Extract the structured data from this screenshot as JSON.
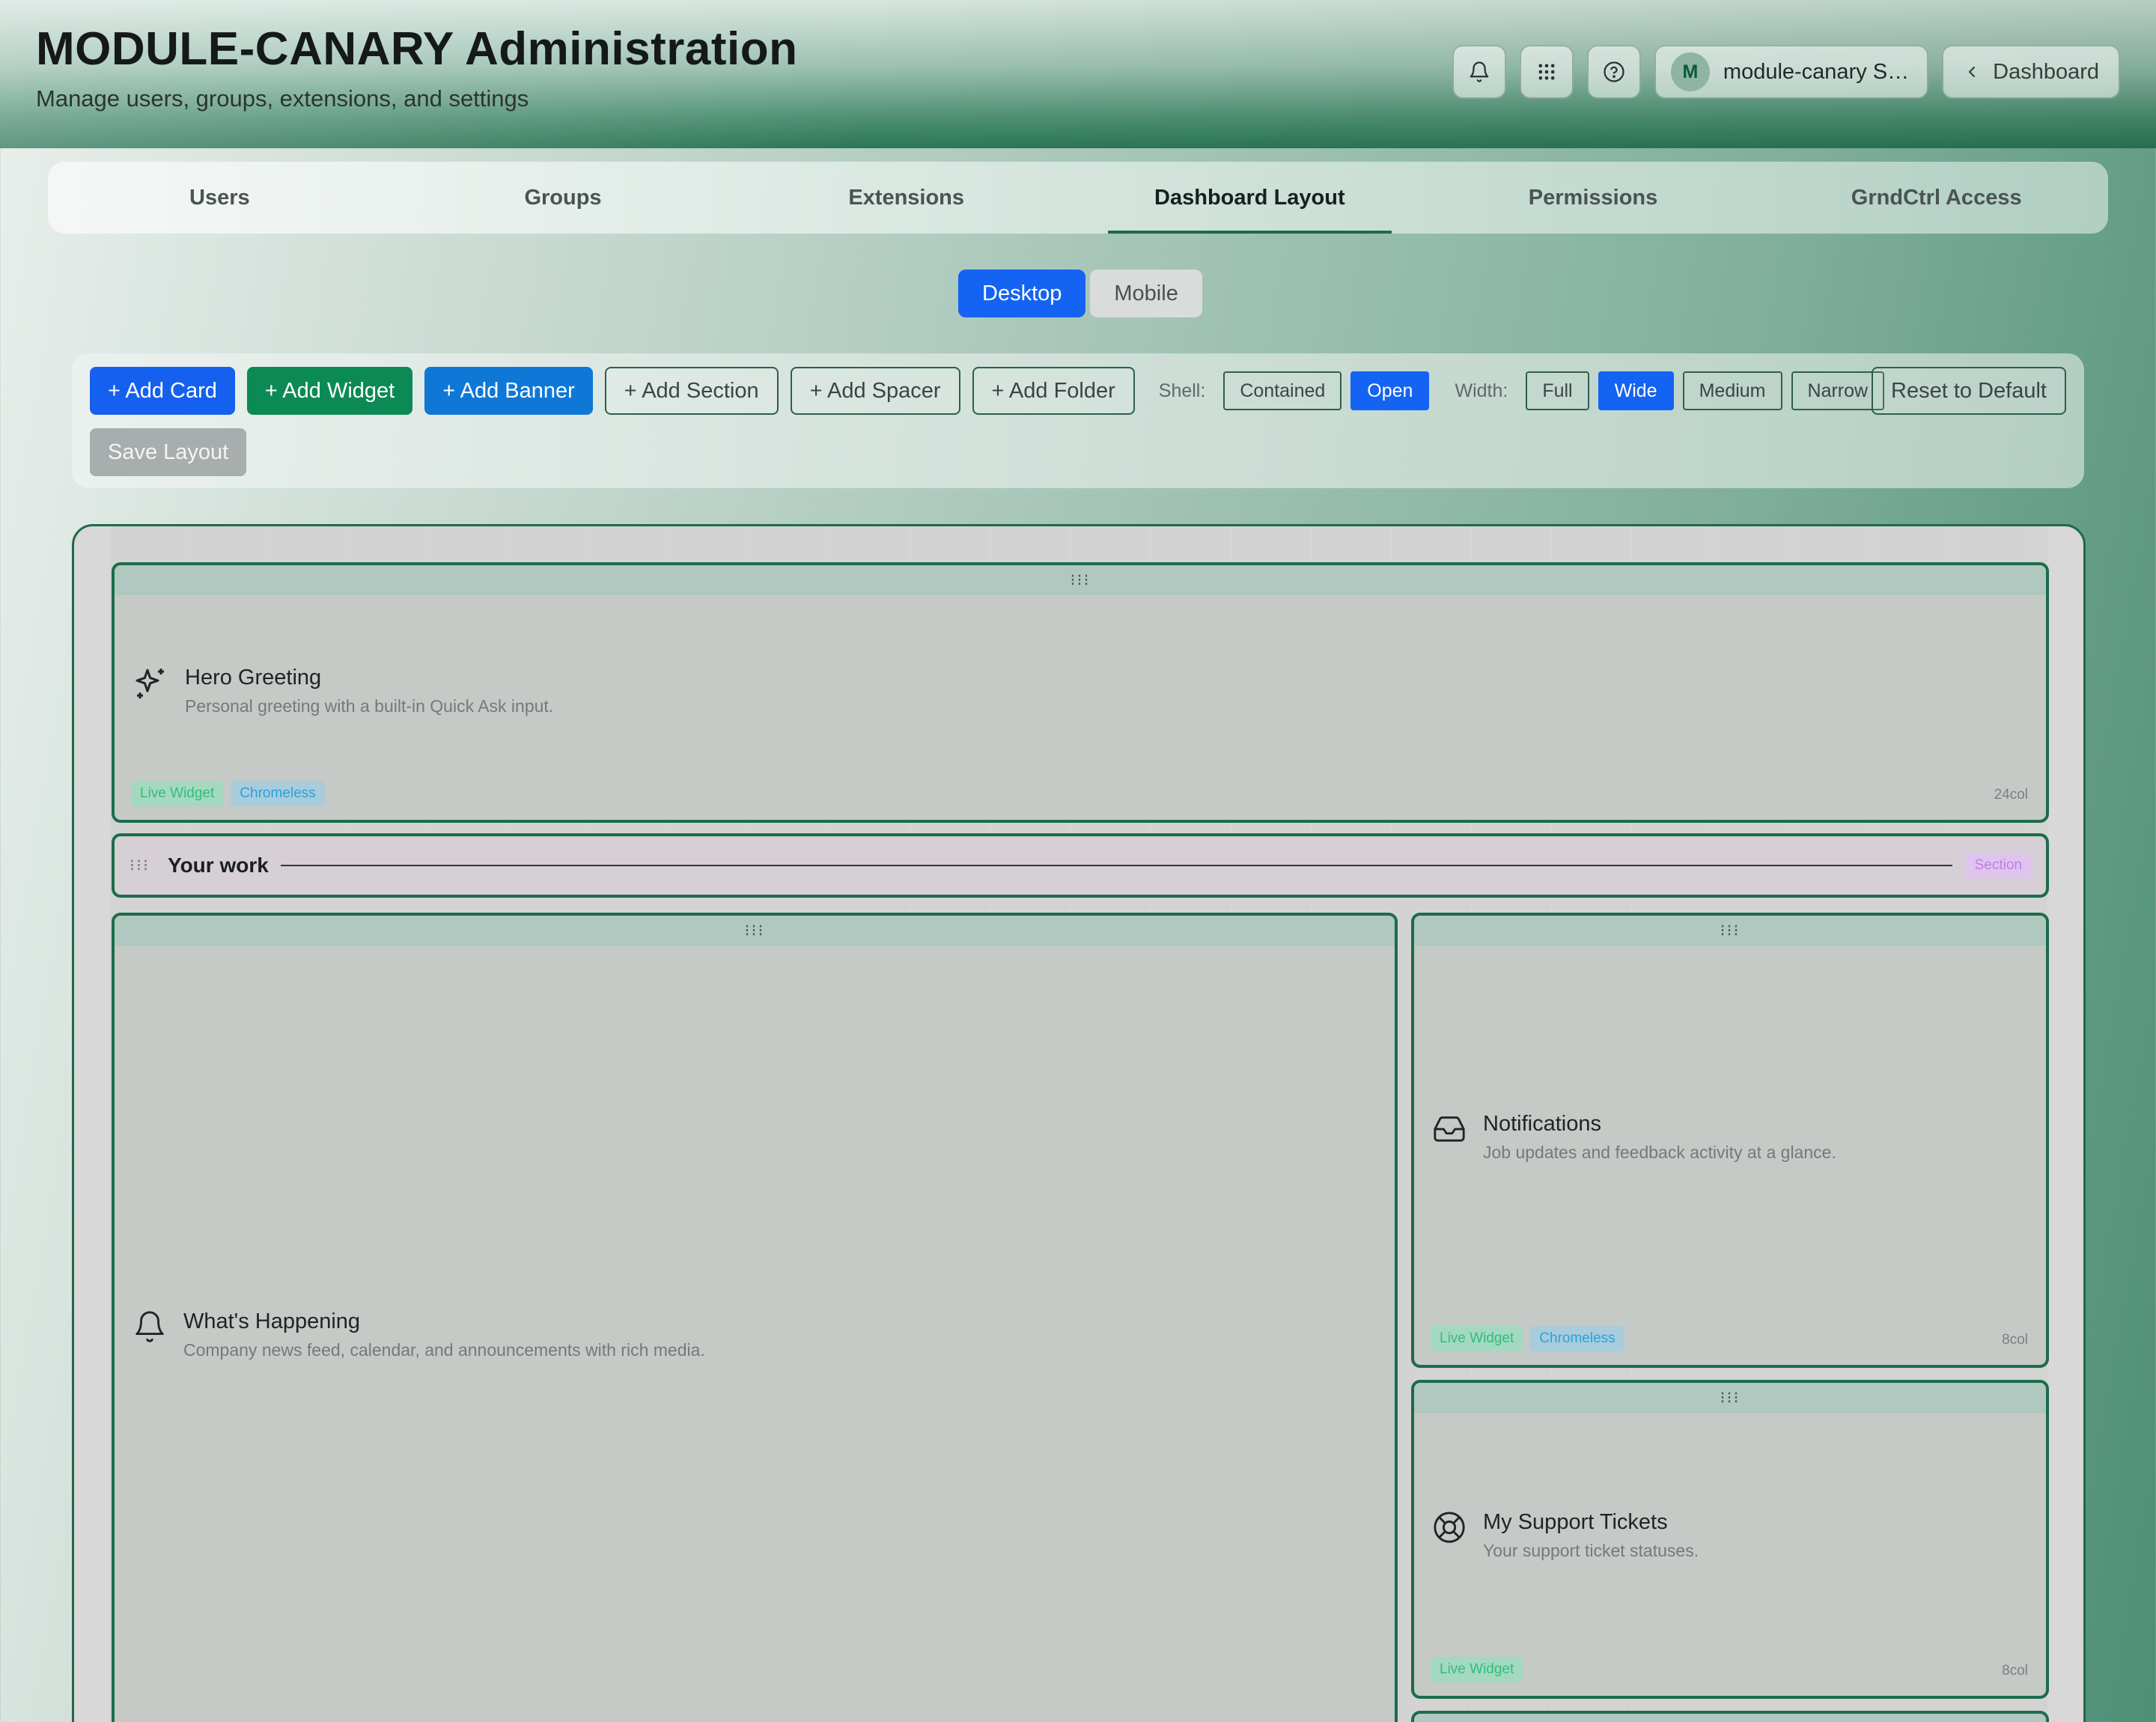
{
  "header": {
    "title": "MODULE-CANARY Administration",
    "subtitle": "Manage users, groups, extensions, and settings",
    "icons": [
      "bell-icon",
      "grid-icon",
      "help-icon"
    ],
    "user": {
      "initial": "M",
      "name": "module-canary S…"
    },
    "back_label": "Dashboard"
  },
  "tabs": [
    {
      "label": "Users",
      "active": false
    },
    {
      "label": "Groups",
      "active": false
    },
    {
      "label": "Extensions",
      "active": false
    },
    {
      "label": "Dashboard Layout",
      "active": true
    },
    {
      "label": "Permissions",
      "active": false
    },
    {
      "label": "GrndCtrl Access",
      "active": false
    }
  ],
  "view_toggle": {
    "desktop": "Desktop",
    "mobile": "Mobile",
    "selected": "Desktop"
  },
  "toolbar": {
    "add_card": "+ Add Card",
    "add_widget": "+ Add Widget",
    "add_banner": "+ Add Banner",
    "add_section": "+ Add Section",
    "add_spacer": "+ Add Spacer",
    "add_folder": "+ Add Folder",
    "shell_label": "Shell:",
    "shell_options": [
      "Contained",
      "Open"
    ],
    "shell_selected": "Open",
    "width_label": "Width:",
    "width_options": [
      "Full",
      "Wide",
      "Medium",
      "Narrow"
    ],
    "width_selected": "Wide",
    "reset": "Reset to Default",
    "save": "Save Layout"
  },
  "layout": {
    "hero": {
      "title": "Hero Greeting",
      "description": "Personal greeting with a built-in Quick Ask input.",
      "icon": "sparkle-icon",
      "badges": [
        "Live Widget",
        "Chromeless"
      ],
      "cols": "24col"
    },
    "section": {
      "title": "Your work",
      "badge": "Section"
    },
    "happening": {
      "title": "What's Happening",
      "description": "Company news feed, calendar, and announcements with rich media.",
      "icon": "bell-icon"
    },
    "notifications": {
      "title": "Notifications",
      "description": "Job updates and feedback activity at a glance.",
      "icon": "inbox-icon",
      "badges": [
        "Live Widget",
        "Chromeless"
      ],
      "cols": "8col"
    },
    "tickets": {
      "title": "My Support Tickets",
      "description": "Your support ticket statuses.",
      "icon": "lifebuoy-icon",
      "badges": [
        "Live Widget"
      ],
      "cols": "8col"
    }
  },
  "colors": {
    "primary": "#1463f3",
    "success": "#0c8a56",
    "brand_border": "#1c6d4a"
  }
}
